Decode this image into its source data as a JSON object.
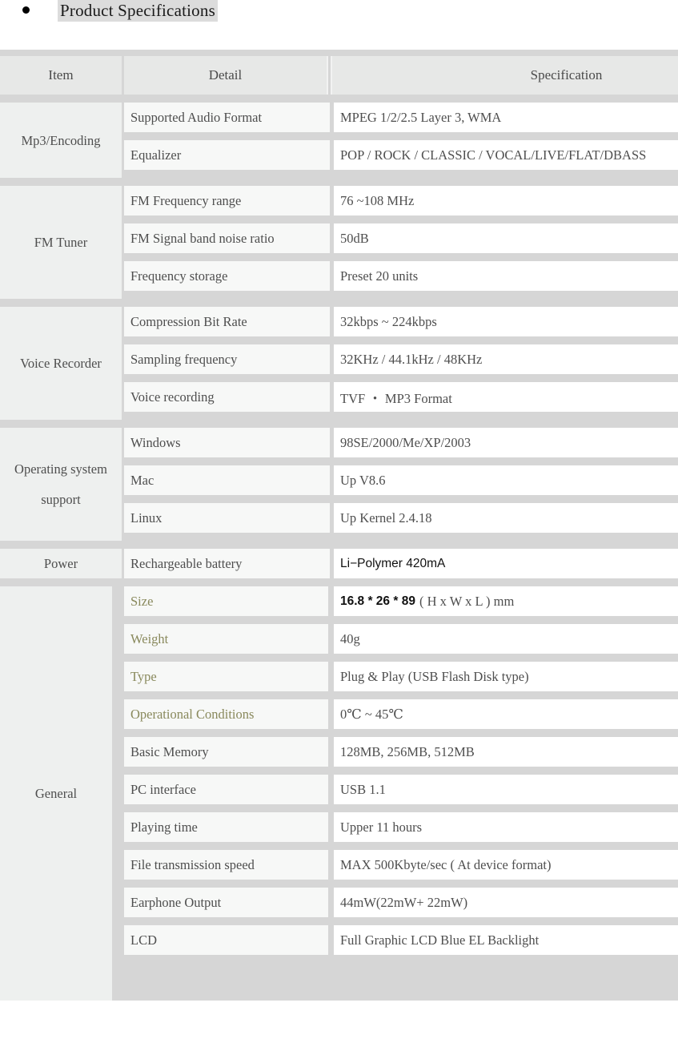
{
  "page": {
    "title": "Product Specifications",
    "bullet_icon": "bullet-dot-icon",
    "title_highlight_color": "#dcdcdc",
    "gap_color": "#d6d6d6",
    "item_cell_color": "#eef0ef",
    "detail_cell_color": "#f7f8f7",
    "spec_cell_color": "#ffffff",
    "accent_olive": "#89895c"
  },
  "table": {
    "headers": {
      "item": "Item",
      "detail": "Detail",
      "specification": "Specification"
    },
    "sections": [
      {
        "item": "Mp3/Encoding",
        "rows": [
          {
            "detail": "Supported Audio Format",
            "spec": "MPEG 1/2/2.5 Layer 3, WMA"
          },
          {
            "detail": "Equalizer",
            "spec": "POP / ROCK / CLASSIC / VOCAL/LIVE/FLAT/DBASS"
          }
        ]
      },
      {
        "item": "FM Tuner",
        "rows": [
          {
            "detail": "FM Frequency range",
            "spec": "76 ~108 MHz"
          },
          {
            "detail": "FM Signal band noise ratio",
            "spec": "50dB"
          },
          {
            "detail": "Frequency storage",
            "spec": "Preset 20 units"
          }
        ]
      },
      {
        "item": "Voice Recorder",
        "rows": [
          {
            "detail": "Compression Bit Rate",
            "spec": "32kbps ~ 224kbps"
          },
          {
            "detail": "Sampling frequency",
            "spec": "32KHz / 44.1kHz / 48KHz"
          },
          {
            "detail": "Voice recording",
            "spec": "TVF ・ MP3 Format"
          }
        ]
      },
      {
        "item": "Operating system support",
        "rows": [
          {
            "detail": "Windows",
            "spec": "98SE/2000/Me/XP/2003"
          },
          {
            "detail": "Mac",
            "spec": "Up V8.6"
          },
          {
            "detail": "Linux",
            "spec": "Up Kernel 2.4.18"
          }
        ]
      },
      {
        "item": "Power",
        "rows": [
          {
            "detail": "Rechargeable battery",
            "spec": "Li−Polymer 420mA"
          }
        ]
      },
      {
        "item": "General",
        "rows": [
          {
            "detail": "Size",
            "spec_bold": "16.8 * 26 * 89",
            "spec_tail": "( H x W x L ) mm"
          },
          {
            "detail": "Weight",
            "spec": "40g"
          },
          {
            "detail": "Type",
            "spec": "Plug & Play (USB Flash Disk type)"
          },
          {
            "detail": "Operational Conditions",
            "spec": "0℃ ~ 45℃"
          },
          {
            "detail": "Basic Memory",
            "spec": "128MB, 256MB, 512MB"
          },
          {
            "detail": "PC interface",
            "spec": "USB 1.1"
          },
          {
            "detail": "Playing time",
            "spec": "Upper 11 hours"
          },
          {
            "detail": "File transmission speed",
            "spec": "MAX 500Kbyte/sec ( At device format)"
          },
          {
            "detail": "Earphone Output",
            "spec": "44mW(22mW+ 22mW)"
          },
          {
            "detail": "LCD",
            "spec": "Full Graphic LCD Blue EL Backlight"
          }
        ]
      }
    ]
  }
}
